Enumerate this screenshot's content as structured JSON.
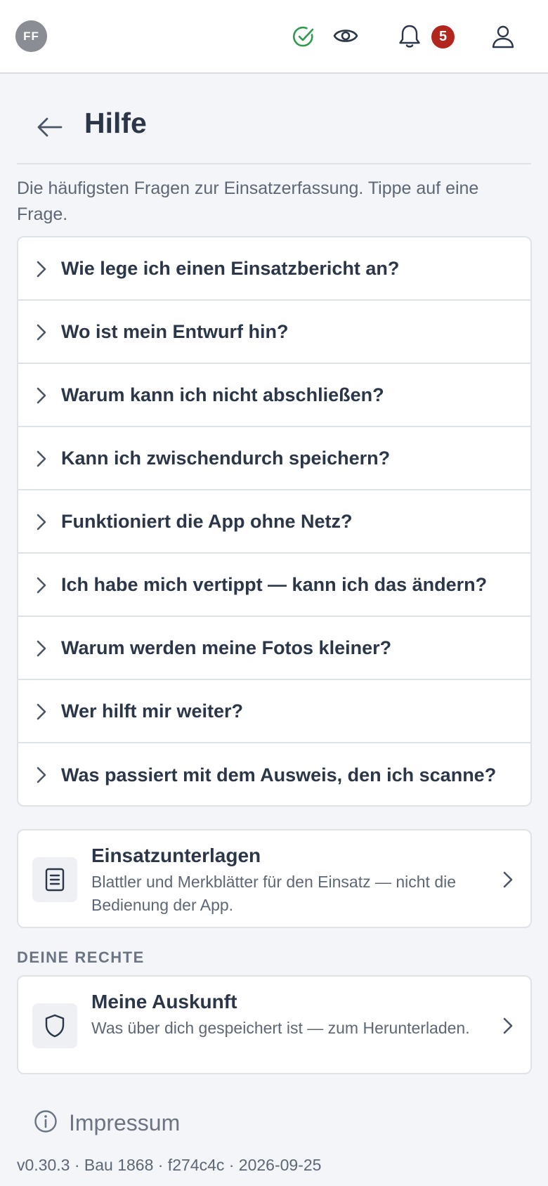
{
  "topbar": {
    "avatar_initials": "FF",
    "status_icon": "check-circle-icon",
    "status_color": "#2e9a4d",
    "notifications_count": "5",
    "badge_color": "#b3261e"
  },
  "header": {
    "title": "Hilfe"
  },
  "intro": "Die häufigsten Fragen zur Einsatzerfassung. Tippe auf eine Frage.",
  "faq": [
    {
      "question": "Wie lege ich einen Einsatzbericht an?"
    },
    {
      "question": "Wo ist mein Entwurf hin?"
    },
    {
      "question": "Warum kann ich nicht abschließen?"
    },
    {
      "question": "Kann ich zwischendurch speichern?"
    },
    {
      "question": "Funktioniert die App ohne Netz?"
    },
    {
      "question": "Ich habe mich vertippt — kann ich das ändern?"
    },
    {
      "question": "Warum werden meine Fotos kleiner?"
    },
    {
      "question": "Wer hilft mir weiter?"
    },
    {
      "question": "Was passiert mit dem Ausweis, den ich scanne?"
    }
  ],
  "documents": {
    "title": "Einsatzunterlagen",
    "description": "Blattler und Merkblätter für den Einsatz — nicht die Bedienung der App.",
    "icon": "document-list-icon"
  },
  "rights": {
    "section_label": "DEINE RECHTE",
    "title": "Meine Auskunft",
    "description": "Was über dich gespeichert ist — zum Herunterladen.",
    "icon": "shield-icon"
  },
  "impressum": {
    "label": "Impressum",
    "icon": "info-icon"
  },
  "version": "v0.30.3 · Bau 1868 · f274c4c · 2026-09-25"
}
